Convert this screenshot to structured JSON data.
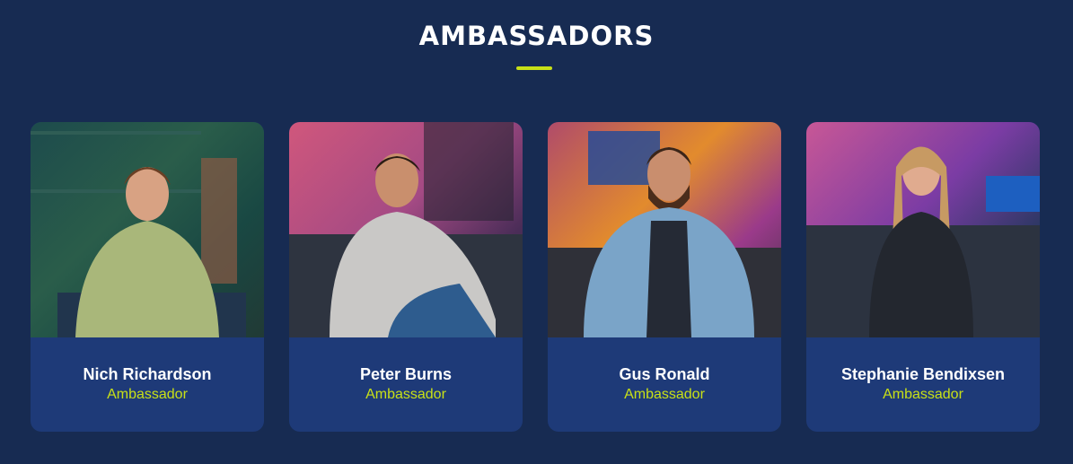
{
  "section": {
    "title": "AMBASSADORS",
    "accent_color": "#c8e017",
    "background_color": "#172b52"
  },
  "ambassadors": [
    {
      "name": "Nich Richardson",
      "role": "Ambassador"
    },
    {
      "name": "Peter Burns",
      "role": "Ambassador"
    },
    {
      "name": "Gus Ronald",
      "role": "Ambassador"
    },
    {
      "name": "Stephanie Bendixsen",
      "role": "Ambassador"
    }
  ]
}
